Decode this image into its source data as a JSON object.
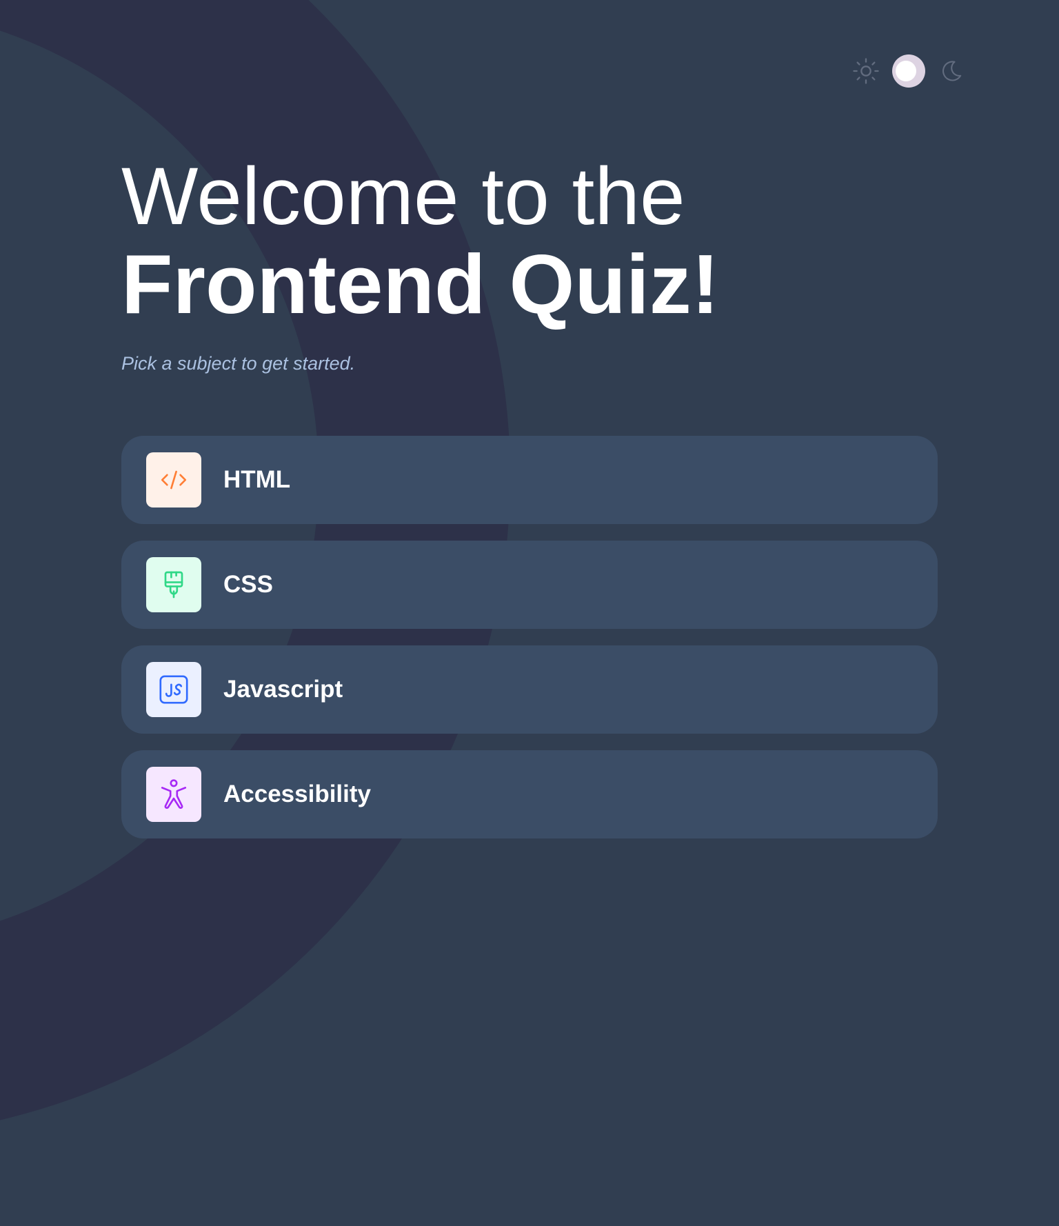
{
  "theme": {
    "current": "dark",
    "sun_icon": "sun-icon",
    "moon_icon": "moon-icon",
    "toggle_state": "on"
  },
  "heading": {
    "line1": "Welcome to the",
    "line2": "Frontend Quiz!"
  },
  "subtitle": "Pick a subject to get started.",
  "subjects": [
    {
      "label": "HTML",
      "icon": "code-icon",
      "icon_bg": "#fff1e9",
      "icon_color": "#ff7e35"
    },
    {
      "label": "CSS",
      "icon": "paintbrush-icon",
      "icon_bg": "#e0fdef",
      "icon_color": "#2fd887"
    },
    {
      "label": "Javascript",
      "icon": "js-icon",
      "icon_bg": "#ebf0ff",
      "icon_color": "#306aff"
    },
    {
      "label": "Accessibility",
      "icon": "accessibility-icon",
      "icon_bg": "#f6e7ff",
      "icon_color": "#a729f5"
    }
  ],
  "colors": {
    "background": "#313e51",
    "card": "#3b4d66",
    "subtitle": "#abc1e1",
    "pattern": "#2d3149"
  }
}
